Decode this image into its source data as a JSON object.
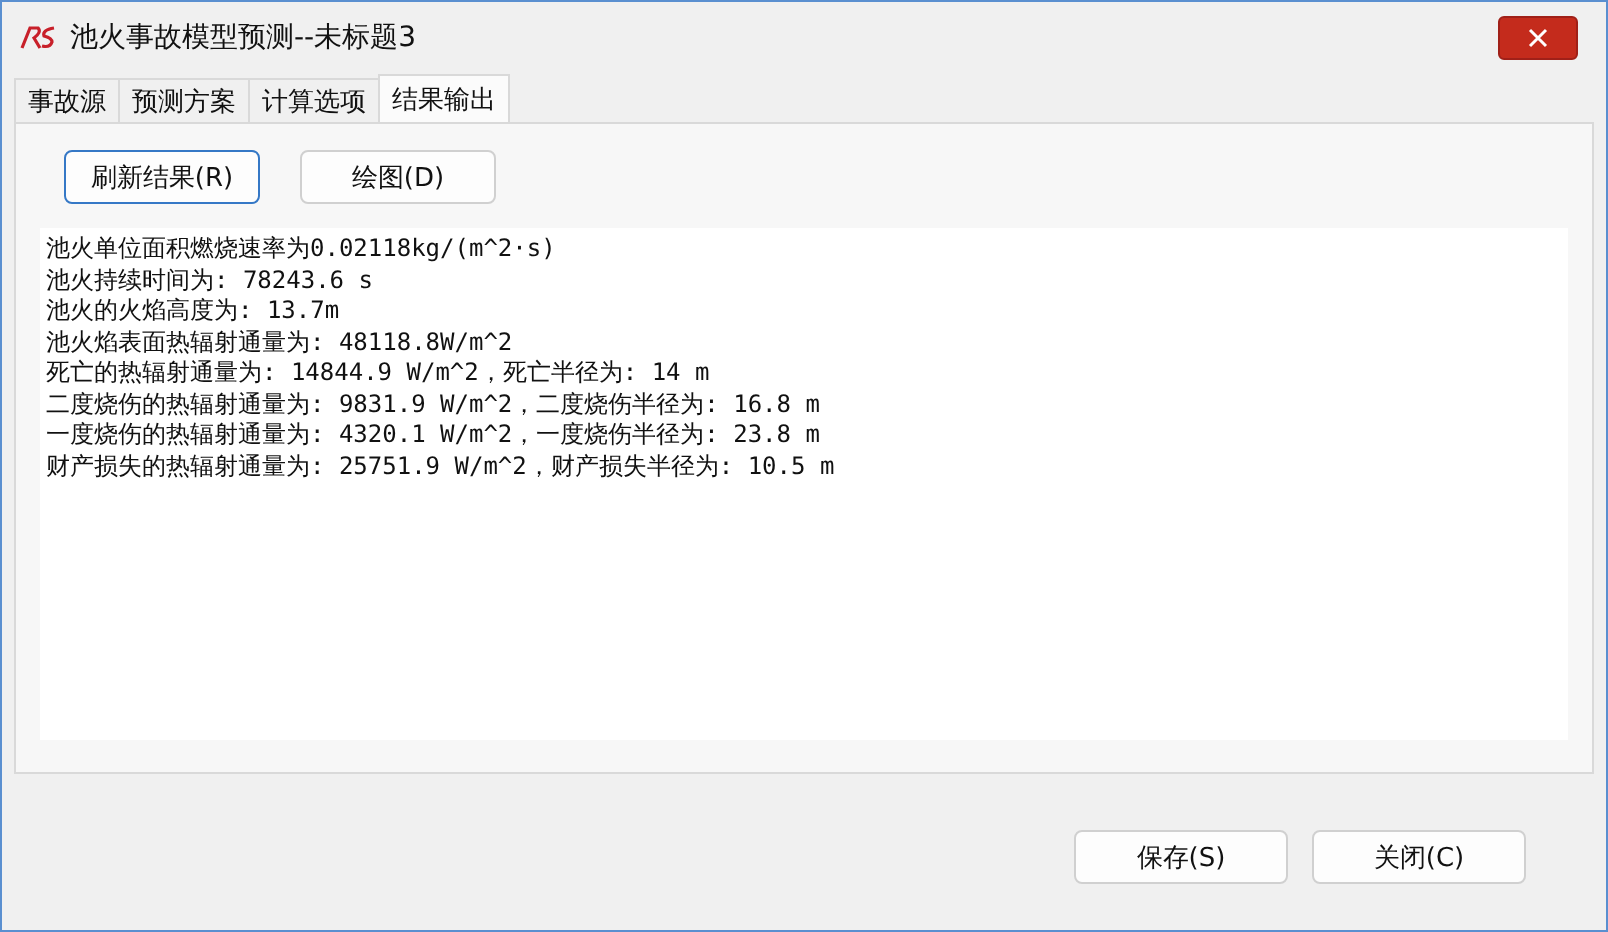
{
  "window": {
    "title": "池火事故模型预测--未标题3"
  },
  "tabs": [
    {
      "label": "事故源",
      "selected": false
    },
    {
      "label": "预测方案",
      "selected": false
    },
    {
      "label": "计算选项",
      "selected": false
    },
    {
      "label": "结果输出",
      "selected": true
    }
  ],
  "toolbar_buttons": [
    {
      "label": "刷新结果(R)",
      "focused": true
    },
    {
      "label": "绘图(D)",
      "focused": false
    }
  ],
  "result_lines": [
    "池火单位面积燃烧速率为0.02118kg/(m^2·s)",
    "池火持续时间为: 78243.6 s",
    "池火的火焰高度为: 13.7m",
    "池火焰表面热辐射通量为: 48118.8W/m^2",
    "死亡的热辐射通量为: 14844.9 W/m^2，死亡半径为: 14 m",
    "二度烧伤的热辐射通量为: 9831.9 W/m^2，二度烧伤半径为: 16.8 m",
    "一度烧伤的热辐射通量为: 4320.1 W/m^2，一度烧伤半径为: 23.8 m",
    "财产损失的热辐射通量为: 25751.9 W/m^2，财产损失半径为: 10.5 m"
  ],
  "footer_buttons": [
    "保存(S)",
    "关闭(C)"
  ]
}
